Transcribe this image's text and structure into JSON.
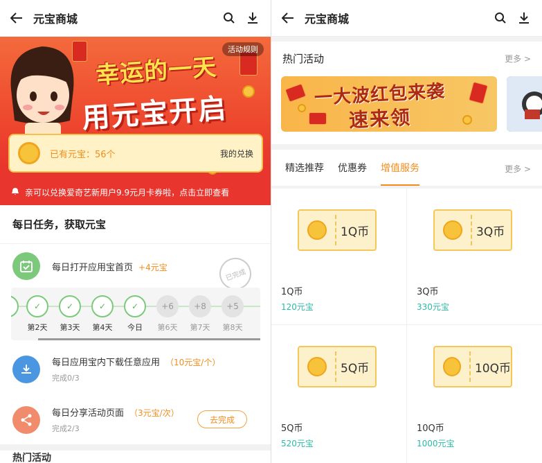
{
  "left": {
    "title": "元宝商城",
    "banner": {
      "rules": "活动规则",
      "headline1": "幸运的一天",
      "headline2": "用元宝开启",
      "balance_label": "已有元宝：56个",
      "my_exchange": "我的兑换",
      "notice": "亲可以兑换爱奇艺新用户9.9元月卡券啦，点击立即查看"
    },
    "tasks_title": "每日任务，获取元宝",
    "tasks": [
      {
        "name": "每日打开应用宝首页",
        "reward": "+4元宝",
        "progress": ""
      },
      {
        "name": "每日应用宝内下载任意应用",
        "reward": "（10元宝/个）",
        "progress": "完成0/3"
      },
      {
        "name": "每日分享活动页面",
        "reward": "（3元宝/次）",
        "progress": "完成2/3"
      }
    ],
    "stamp": "已完成",
    "checkin": [
      {
        "label": "天",
        "value": "",
        "done": true
      },
      {
        "label": "第2天",
        "value": "",
        "done": true
      },
      {
        "label": "第3天",
        "value": "",
        "done": true
      },
      {
        "label": "第4天",
        "value": "",
        "done": true
      },
      {
        "label": "今日",
        "value": "",
        "done": true
      },
      {
        "label": "第6天",
        "value": "+6",
        "done": false
      },
      {
        "label": "第7天",
        "value": "+8",
        "done": false
      },
      {
        "label": "第8天",
        "value": "+5",
        "done": false
      }
    ],
    "share_button": "去完成",
    "bottom_section": "热门活动"
  },
  "right": {
    "title": "元宝商城",
    "hot_title": "热门活动",
    "more": "更多 >",
    "hot_banner_line1": "一大波红包来袭",
    "hot_banner_line2": "速来领",
    "tabs": [
      "精选推荐",
      "优惠券",
      "增值服务"
    ],
    "active_tab": 2,
    "tabs_more": "更多 >",
    "products": [
      {
        "amount": "1Q币",
        "name": "1Q币",
        "price": "120元宝"
      },
      {
        "amount": "3Q币",
        "name": "3Q币",
        "price": "330元宝"
      },
      {
        "amount": "5Q币",
        "name": "5Q币",
        "price": "520元宝"
      },
      {
        "amount": "10Q币",
        "name": "10Q币",
        "price": "1000元宝"
      }
    ]
  },
  "colors": {
    "accent": "#f08d1c",
    "banner_red": "#e8352d",
    "price_teal": "#2cb9a5",
    "check_green": "#7cc97b"
  }
}
